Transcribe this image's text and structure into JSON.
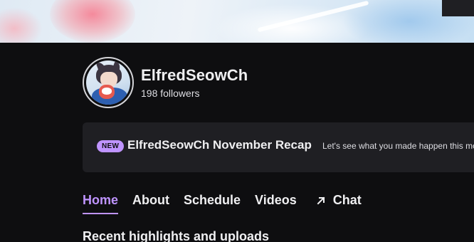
{
  "channel": {
    "name": "ElfredSeowCh",
    "followers": "198 followers"
  },
  "recap": {
    "badge": "NEW",
    "title": "ElfredSeowCh November Recap",
    "description": "Let's see what you made happen this month!"
  },
  "tabs": [
    {
      "label": "Home",
      "active": true
    },
    {
      "label": "About",
      "active": false
    },
    {
      "label": "Schedule",
      "active": false
    },
    {
      "label": "Videos",
      "active": false
    },
    {
      "label": "Chat",
      "active": false,
      "icon": "arrow-up-right-icon"
    }
  ],
  "section": {
    "title": "Recent highlights and uploads"
  },
  "colors": {
    "accent": "#bf94ff",
    "background": "#0e0e10",
    "card": "#1f1f23",
    "text": "#efeff1"
  }
}
